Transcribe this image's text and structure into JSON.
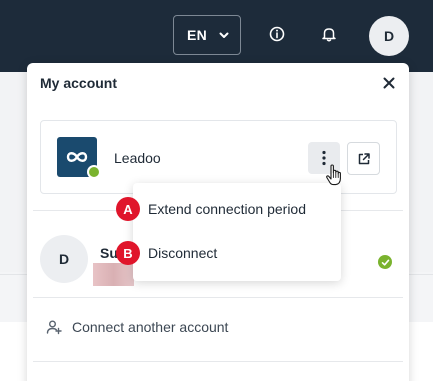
{
  "topbar": {
    "language": "EN",
    "user_initial": "D"
  },
  "panel": {
    "title": "My account",
    "account": {
      "name": "Leadoo"
    },
    "second_account": {
      "initial": "D",
      "name": "Su"
    },
    "connect_label": "Connect another account"
  },
  "context_menu": {
    "items": [
      {
        "badge": "A",
        "label": "Extend connection period"
      },
      {
        "badge": "B",
        "label": "Disconnect"
      }
    ]
  },
  "colors": {
    "topbar_bg": "#1d2b3a",
    "brand_logo": "#1a4a6e",
    "status_green": "#7ab32e",
    "step_badge_red": "#e0152b"
  },
  "icons": {
    "language_chevron": "chevron-down-icon",
    "info": "info-icon",
    "notifications": "bell-icon",
    "close": "close-icon",
    "more": "kebab-menu-icon",
    "external": "external-link-icon",
    "connect": "add-user-icon",
    "status": "check-icon"
  }
}
